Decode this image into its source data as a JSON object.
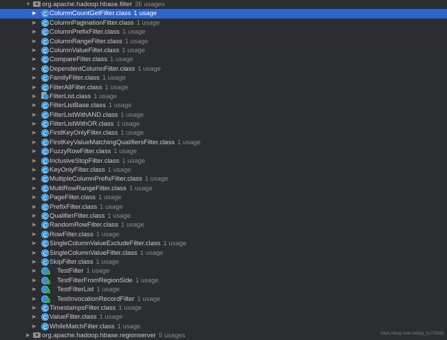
{
  "packages": [
    {
      "name": "org.apache.hadoop.hbase.filter",
      "usage": "35 usages"
    },
    {
      "name": "org.apache.hadoop.hbase.regionserver",
      "usage": "5 usages"
    }
  ],
  "items": [
    {
      "name": "ColumnCountGetFilter.class",
      "usage": "1 usage",
      "icon": "class-icon",
      "selected": true
    },
    {
      "name": "ColumnPaginationFilter.class",
      "usage": "1 usage",
      "icon": "class-icon"
    },
    {
      "name": "ColumnPrefixFilter.class",
      "usage": "1 usage",
      "icon": "class-icon"
    },
    {
      "name": "ColumnRangeFilter.class",
      "usage": "1 usage",
      "icon": "class-icon"
    },
    {
      "name": "ColumnValueFilter.class",
      "usage": "1 usage",
      "icon": "class-icon"
    },
    {
      "name": "CompareFilter.class",
      "usage": "1 usage",
      "icon": "class-icon"
    },
    {
      "name": "DependentColumnFilter.class",
      "usage": "1 usage",
      "icon": "class-icon"
    },
    {
      "name": "FamilyFilter.class",
      "usage": "1 usage",
      "icon": "class-icon"
    },
    {
      "name": "FilterAllFilter.class",
      "usage": "1 usage",
      "icon": "class-icon"
    },
    {
      "name": "FilterList.class",
      "usage": "1 usage",
      "icon": "class-file-icon"
    },
    {
      "name": "FilterListBase.class",
      "usage": "1 usage",
      "icon": "class-icon"
    },
    {
      "name": "FilterListWithAND.class",
      "usage": "1 usage",
      "icon": "class-icon"
    },
    {
      "name": "FilterListWithOR.class",
      "usage": "1 usage",
      "icon": "class-icon"
    },
    {
      "name": "FirstKeyOnlyFilter.class",
      "usage": "1 usage",
      "icon": "class-icon"
    },
    {
      "name": "FirstKeyValueMatchingQualifiersFilter.class",
      "usage": "1 usage",
      "icon": "class-icon"
    },
    {
      "name": "FuzzyRowFilter.class",
      "usage": "1 usage",
      "icon": "class-icon"
    },
    {
      "name": "InclusiveStopFilter.class",
      "usage": "1 usage",
      "icon": "class-icon"
    },
    {
      "name": "KeyOnlyFilter.class",
      "usage": "1 usage",
      "icon": "class-icon"
    },
    {
      "name": "MultipleColumnPrefixFilter.class",
      "usage": "1 usage",
      "icon": "class-icon"
    },
    {
      "name": "MultiRowRangeFilter.class",
      "usage": "1 usage",
      "icon": "class-icon"
    },
    {
      "name": "PageFilter.class",
      "usage": "1 usage",
      "icon": "class-icon"
    },
    {
      "name": "PrefixFilter.class",
      "usage": "1 usage",
      "icon": "class-icon"
    },
    {
      "name": "QualifierFilter.class",
      "usage": "1 usage",
      "icon": "class-icon"
    },
    {
      "name": "RandomRowFilter.class",
      "usage": "1 usage",
      "icon": "class-icon"
    },
    {
      "name": "RowFilter.class",
      "usage": "1 usage",
      "icon": "class-icon"
    },
    {
      "name": "SingleColumnValueExcludeFilter.class",
      "usage": "1 usage",
      "icon": "class-icon"
    },
    {
      "name": "SingleColumnValueFilter.class",
      "usage": "1 usage",
      "icon": "class-icon"
    },
    {
      "name": "SkipFilter.class",
      "usage": "1 usage",
      "icon": "class-icon"
    },
    {
      "name": "TestFilter",
      "usage": "1 usage",
      "icon": "test-class-icon"
    },
    {
      "name": "TestFilterFromRegionSide",
      "usage": "1 usage",
      "icon": "test-class-icon"
    },
    {
      "name": "TestFilterList",
      "usage": "1 usage",
      "icon": "test-class-icon"
    },
    {
      "name": "TestInvocationRecordFilter",
      "usage": "1 usage",
      "icon": "test-class-icon"
    },
    {
      "name": "TimestampsFilter.class",
      "usage": "1 usage",
      "icon": "class-icon"
    },
    {
      "name": "ValueFilter.class",
      "usage": "1 usage",
      "icon": "class-icon"
    },
    {
      "name": "WhileMatchFilter.class",
      "usage": "1 usage",
      "icon": "class-icon"
    }
  ],
  "watermark": "https://blog.csdn.net/qq_31725391",
  "colors": {
    "background": "#2b2d30",
    "selection": "#2f65ca",
    "usage_text": "#8a8d92",
    "class_icon": "#3d8fcf",
    "test_badge": "#39a846"
  }
}
